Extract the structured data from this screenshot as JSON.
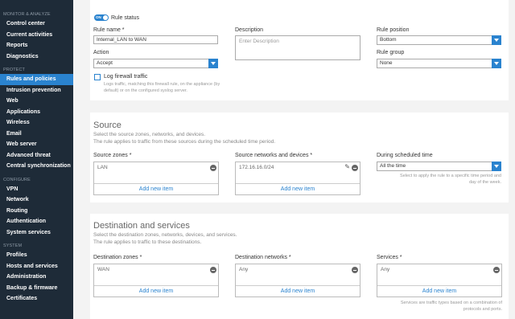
{
  "sidebar": {
    "sections": [
      {
        "title": "MONITOR & ANALYZE",
        "items": [
          "Control center",
          "Current activities",
          "Reports",
          "Diagnostics"
        ]
      },
      {
        "title": "PROTECT",
        "items": [
          "Rules and policies",
          "Intrusion prevention",
          "Web",
          "Applications",
          "Wireless",
          "Email",
          "Web server",
          "Advanced threat",
          "Central synchronization"
        ]
      },
      {
        "title": "CONFIGURE",
        "items": [
          "VPN",
          "Network",
          "Routing",
          "Authentication",
          "System services"
        ]
      },
      {
        "title": "SYSTEM",
        "items": [
          "Profiles",
          "Hosts and services",
          "Administration",
          "Backup & firmware",
          "Certificates"
        ]
      }
    ],
    "active": "Rules and policies"
  },
  "rule": {
    "status_toggle": "ON",
    "status_label": "Rule status",
    "name_label": "Rule name *",
    "name_value": "Internal_LAN to WAN",
    "action_label": "Action",
    "action_value": "Accept",
    "log_label": "Log firewall traffic",
    "log_help": "Logs traffic, matching this firewall rule, on the appliance (by default) or on the configured syslog server.",
    "description_label": "Description",
    "description_placeholder": "Enter Description",
    "position_label": "Rule position",
    "position_value": "Bottom",
    "group_label": "Rule group",
    "group_value": "None"
  },
  "source": {
    "title": "Source",
    "desc1": "Select the source zones, networks, and devices.",
    "desc2": "The rule applies to traffic from these sources during the scheduled time period.",
    "zones_label": "Source zones *",
    "zones_value": "LAN",
    "networks_label": "Source networks and devices *",
    "networks_value": "172.16.16.0/24",
    "schedule_label": "During scheduled time",
    "schedule_value": "All the time",
    "schedule_help": "Select to apply the rule to a specific time period and day of the week.",
    "add_new": "Add new item"
  },
  "destination": {
    "title": "Destination and services",
    "desc1": "Select the destination zones, networks, devices, and services.",
    "desc2": "The rule applies to traffic to these destinations.",
    "zones_label": "Destination zones *",
    "zones_value": "WAN",
    "networks_label": "Destination networks *",
    "networks_value": "Any",
    "services_label": "Services *",
    "services_value": "Any",
    "services_help": "Services are traffic types based on a combination of protocols and ports.",
    "add_new": "Add new item"
  },
  "colors": {
    "accent": "#2a83cf",
    "sidebar_bg": "#1e2b38"
  }
}
